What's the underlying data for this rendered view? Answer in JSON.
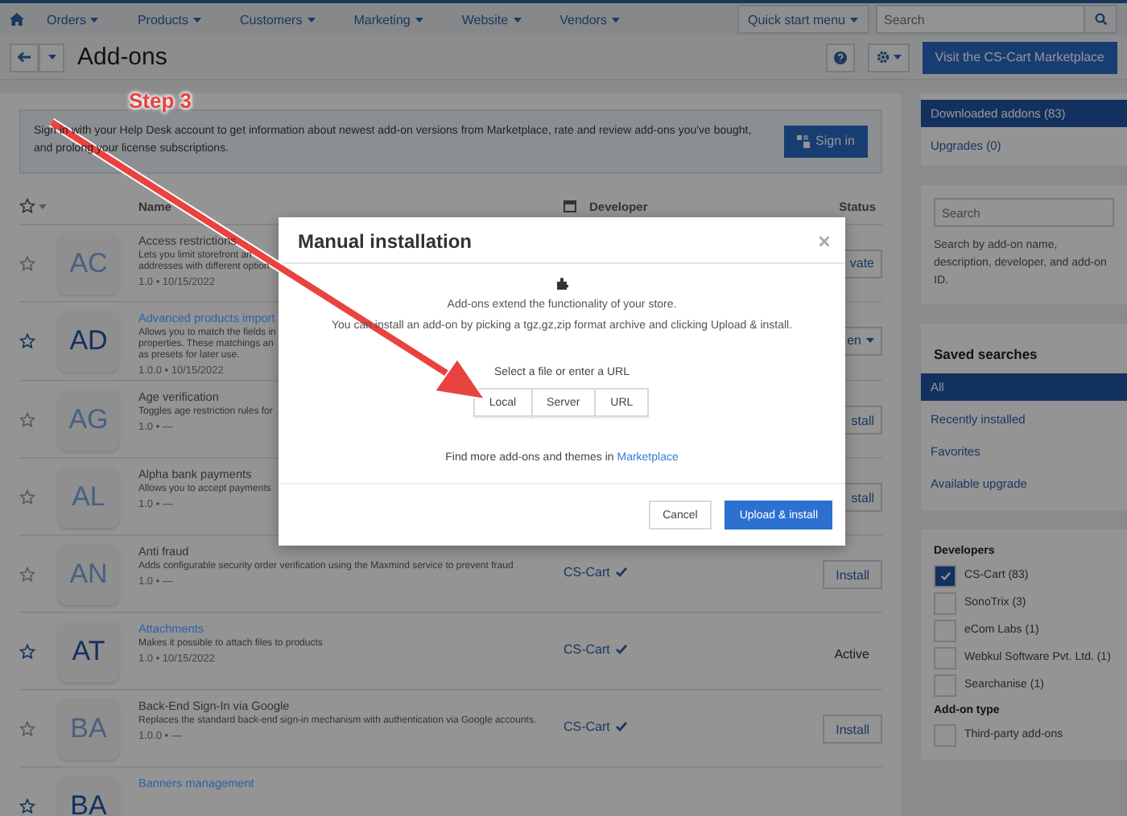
{
  "nav": {
    "items": [
      {
        "label": "Orders"
      },
      {
        "label": "Products"
      },
      {
        "label": "Customers"
      },
      {
        "label": "Marketing"
      },
      {
        "label": "Website"
      },
      {
        "label": "Vendors"
      }
    ],
    "quick_menu": "Quick start menu",
    "search": {
      "placeholder": "Search"
    }
  },
  "header": {
    "title": "Add-ons",
    "marketplace_button": "Visit the CS-Cart Marketplace"
  },
  "annotation": {
    "label": "Step 3"
  },
  "signin_notice": {
    "text": "Sign in with your Help Desk account to get information about newest add-on versions from Marketplace, rate and review add-ons you've bought, and prolong your license subscriptions.",
    "button": "Sign in"
  },
  "table": {
    "columns": {
      "name": "Name",
      "developer": "Developer",
      "status": "Status"
    },
    "rows": [
      {
        "initials": "AC",
        "name": "Access restrictions",
        "installed": false,
        "description": "Lets you limit storefront an addresses with different option",
        "meta": "1.0 • 10/15/2022",
        "status": {
          "kind": "button",
          "label": "vate",
          "cut": true
        }
      },
      {
        "initials": "AD",
        "name": "Advanced products import",
        "installed": true,
        "description": "Allows you to match the fields in properties. These matchings an as presets for later use.",
        "meta": "1.0.0 • 10/15/2022",
        "status": {
          "kind": "dropdown",
          "label": "en",
          "cut": true
        }
      },
      {
        "initials": "AG",
        "name": "Age verification",
        "installed": false,
        "description": "Toggles age restriction rules for",
        "meta": "1.0 • —",
        "status": {
          "kind": "button",
          "label": "stall",
          "cut": true
        }
      },
      {
        "initials": "AL",
        "name": "Alpha bank payments",
        "installed": false,
        "description": "Allows you to accept payments",
        "meta": "1.0 • —",
        "status": {
          "kind": "button",
          "label": "stall",
          "cut": true
        }
      },
      {
        "initials": "AN",
        "name": "Anti fraud",
        "installed": false,
        "description": "Adds configurable security order verification using the Maxmind service to prevent fraud",
        "meta": "1.0 • —",
        "developer": "CS-Cart",
        "status": {
          "kind": "button",
          "label": "Install",
          "cut": false
        }
      },
      {
        "initials": "AT",
        "name": "Attachments",
        "installed": true,
        "description": "Makes it possible to attach files to products",
        "meta": "1.0 • 10/15/2022",
        "developer": "CS-Cart",
        "status": {
          "kind": "text",
          "label": "Active",
          "cut": false
        }
      },
      {
        "initials": "BA",
        "name": "Back-End Sign-In via Google",
        "installed": false,
        "description": "Replaces the standard back-end sign-in mechanism with authentication via Google accounts.",
        "meta": "1.0.0 • —",
        "developer": "CS-Cart",
        "status": {
          "kind": "button",
          "label": "Install",
          "cut": false
        }
      },
      {
        "initials": "BA",
        "name": "Banners management",
        "installed": true
      }
    ]
  },
  "sidebar": {
    "sources": [
      {
        "label": "Downloaded addons (83)",
        "selected": true
      },
      {
        "label": "Upgrades (0)",
        "selected": false
      }
    ],
    "search": {
      "placeholder": "Search",
      "help": "Search by add-on name, description, developer, and add-on ID."
    },
    "saved_searches": {
      "title": "Saved searches",
      "items": [
        {
          "label": "All",
          "selected": true
        },
        {
          "label": "Recently installed",
          "selected": false
        },
        {
          "label": "Favorites",
          "selected": false
        },
        {
          "label": "Available upgrade",
          "selected": false
        }
      ]
    },
    "filters": [
      {
        "title": "Developers",
        "options": [
          {
            "label": "CS-Cart (83)",
            "checked": true
          },
          {
            "label": "SonoTrix (3)",
            "checked": false
          },
          {
            "label": "eCom Labs (1)",
            "checked": false
          },
          {
            "label": "Webkul Software Pvt. Ltd. (1)",
            "checked": false
          },
          {
            "label": "Searchanise (1)",
            "checked": false
          }
        ]
      },
      {
        "title": "Add-on type",
        "options": [
          {
            "label": "Third-party add-ons",
            "checked": false
          }
        ]
      }
    ]
  },
  "modal": {
    "title": "Manual installation",
    "intro": "Add-ons extend the functionality of your store.",
    "instructions": "You can install an add-on by picking a tgz,gz,zip format archive and clicking Upload & install.",
    "source_prompt": "Select a file or enter a URL",
    "sources": [
      {
        "label": "Local",
        "selected": false
      },
      {
        "label": "Server",
        "selected": false
      },
      {
        "label": "URL",
        "selected": false
      }
    ],
    "marketplace_text": "Find more add-ons and themes in",
    "marketplace_link": "Marketplace",
    "cancel": "Cancel",
    "submit": "Upload & install"
  }
}
